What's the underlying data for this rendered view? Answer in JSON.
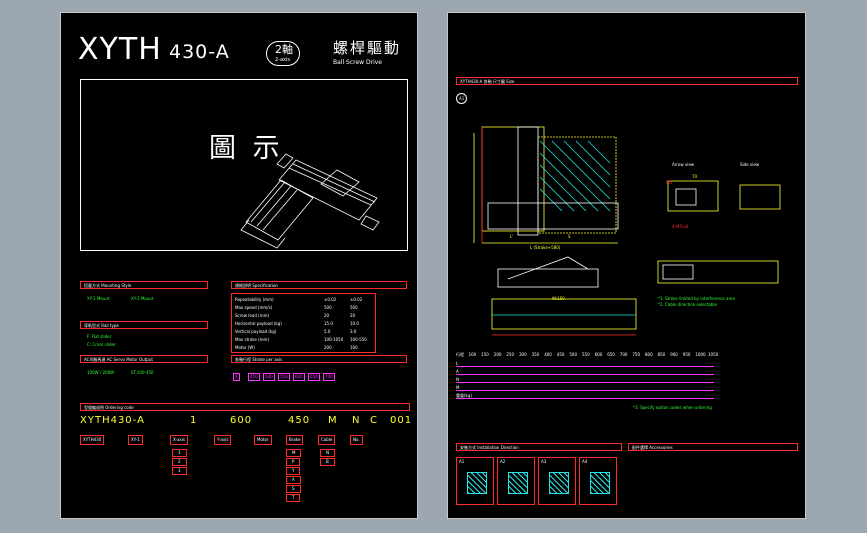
{
  "title": {
    "model": "XYTH",
    "number": "430-A",
    "axis": "2軸",
    "axis_sub": "2-axis",
    "drive_zh": "螺桿驅動",
    "drive_en": "Ball Screw Drive"
  },
  "figure_label": "圖 示",
  "left": {
    "sections": [
      "搭載方式 Mounting Style",
      "規格說明 Specification",
      "導軌型式 Rail type",
      "AC伺服馬達 AC Servo Motor Output",
      "各軸行程 Stroke per axis"
    ],
    "options": [
      "XY-1 Mount",
      "XY-2 Mount",
      "F: Flat slider",
      "C: Cross slider",
      "100W / 200W",
      "ST:100-450"
    ],
    "spec_rows": [
      {
        "label": "Repeatability (mm)",
        "x": "±0.02",
        "y": "±0.02"
      },
      {
        "label": "Max speed (mm/s)",
        "x": "500",
        "y": "500"
      },
      {
        "label": "Screw lead (mm)",
        "x": "20",
        "y": "20"
      },
      {
        "label": "Horizontal payload (kg)",
        "x": "15.0",
        "y": "10.0"
      },
      {
        "label": "Vertical payload (kg)",
        "x": "5.0",
        "y": "3.0"
      },
      {
        "label": "Max stroke (mm)",
        "x": "100-1050",
        "y": "100-550"
      },
      {
        "label": "Motor (W)",
        "x": "200",
        "y": "100"
      }
    ],
    "stroke_row": [
      "X",
      "450",
      "500",
      "550",
      "600",
      "650",
      "700"
    ],
    "ordering_label": "型號編成例 Ordering code",
    "ordering_code": [
      "XYTH430-A",
      "1",
      "600",
      "450",
      "M",
      "N",
      "C",
      "001"
    ],
    "code_boxes": [
      "XYTH430",
      "XY-1",
      "X-axis",
      "Y-axis",
      "Motor",
      "Brake",
      "Cable",
      "No."
    ],
    "code_options_a": [
      "1",
      "2",
      "3"
    ],
    "code_options_b": [
      "M",
      "P",
      "Y",
      "A",
      "S",
      "T"
    ],
    "code_options_c": [
      "N",
      "B"
    ]
  },
  "right": {
    "header": "XYTH430-A 各軸 尺寸圖 Size",
    "mark": "A1",
    "dims": [
      "L (Stroke+580)",
      "S",
      "L'",
      "4-M5×8",
      "M5",
      "W:150",
      "70"
    ],
    "view_labels": [
      "Arrow view",
      "Side view"
    ],
    "table_header": [
      "行程",
      "100",
      "150",
      "200",
      "250",
      "300",
      "350",
      "400",
      "450",
      "500",
      "550",
      "600",
      "650",
      "700",
      "750",
      "800",
      "850",
      "900",
      "950",
      "1000",
      "1050"
    ],
    "table_rows": [
      "L",
      "A",
      "N",
      "M",
      "重量(kg)"
    ],
    "notes": [
      "*1. Stroke limited by interference area",
      "*2. Cable direction selectable",
      "*3. Specify option codes when ordering"
    ],
    "accessory_sections": [
      "安裝方式 Installation Direction",
      "配件選擇 Accessories"
    ],
    "install_marks": [
      "A1",
      "A2",
      "A3",
      "A4"
    ]
  },
  "colors": {
    "sheet_bg": "#000000",
    "border": "#ff2a2a",
    "accent": "#ffff33",
    "line": "#22e6e6"
  }
}
